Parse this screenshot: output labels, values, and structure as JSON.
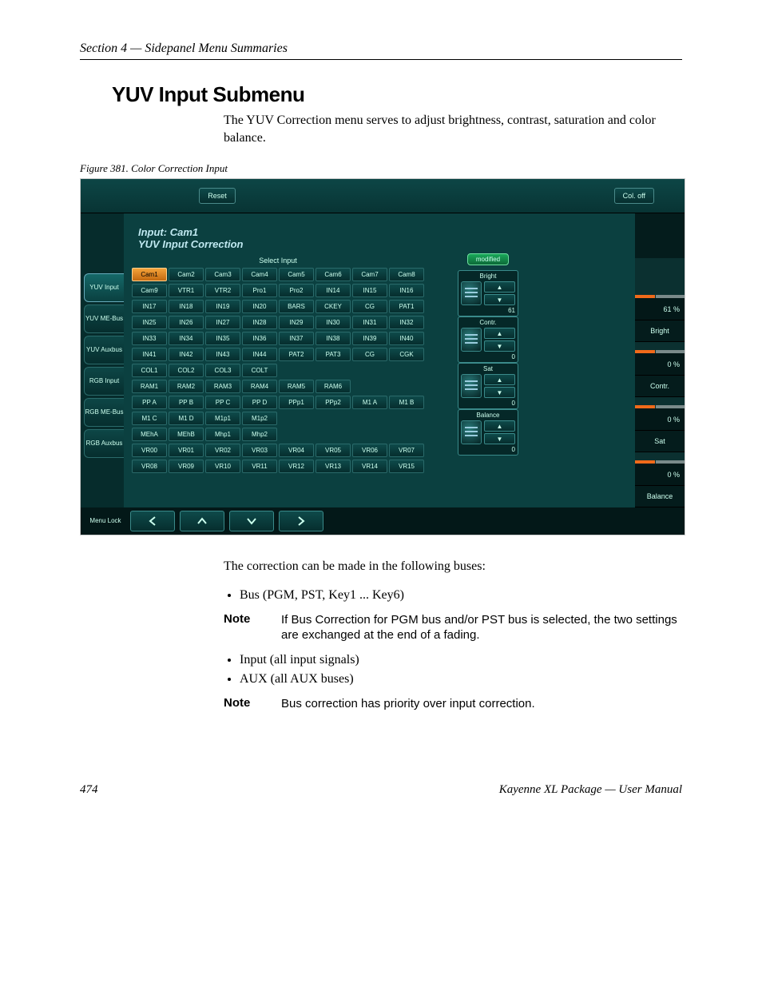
{
  "header": {
    "section": "Section 4 — Sidepanel Menu Summaries"
  },
  "title": "YUV Input Submenu",
  "intro": "The YUV Correction menu serves to adjust brightness, contrast, saturation and color balance.",
  "figure_caption": "Figure 381.  Color Correction Input",
  "ui": {
    "topbar": {
      "reset": "Reset",
      "coloff": "Col. off"
    },
    "panel_input": "Input:  Cam1",
    "panel_name": "YUV Input Correction",
    "select_label": "Select Input",
    "tabs": [
      "YUV Input",
      "YUV ME-Bus",
      "YUV Auxbus",
      "RGB Input",
      "RGB ME-Bus",
      "RGB Auxbus"
    ],
    "grid": [
      [
        "Cam1",
        "Cam2",
        "Cam3",
        "Cam4",
        "Cam5",
        "Cam6",
        "Cam7",
        "Cam8"
      ],
      [
        "Cam9",
        "VTR1",
        "VTR2",
        "Pro1",
        "Pro2",
        "IN14",
        "IN15",
        "IN16"
      ],
      [
        "IN17",
        "IN18",
        "IN19",
        "IN20",
        "BARS",
        "CKEY",
        "CG",
        "PAT1"
      ],
      [
        "IN25",
        "IN26",
        "IN27",
        "IN28",
        "IN29",
        "IN30",
        "IN31",
        "IN32"
      ],
      [
        "IN33",
        "IN34",
        "IN35",
        "IN36",
        "IN37",
        "IN38",
        "IN39",
        "IN40"
      ],
      [
        "IN41",
        "IN42",
        "IN43",
        "IN44",
        "PAT2",
        "PAT3",
        "CG",
        "CGK"
      ],
      [
        "COL1",
        "COL2",
        "COL3",
        "COLT",
        "",
        "",
        "",
        ""
      ],
      [
        "RAM1",
        "RAM2",
        "RAM3",
        "RAM4",
        "RAM5",
        "RAM6",
        "",
        ""
      ],
      [
        "PP A",
        "PP B",
        "PP C",
        "PP D",
        "PPp1",
        "PPp2",
        "M1 A",
        "M1 B"
      ],
      [
        "M1 C",
        "M1 D",
        "M1p1",
        "M1p2",
        "",
        "",
        "",
        ""
      ],
      [
        "MEhA",
        "MEhB",
        "Mhp1",
        "Mhp2",
        "",
        "",
        "",
        ""
      ],
      [
        "VR00",
        "VR01",
        "VR02",
        "VR03",
        "VR04",
        "VR05",
        "VR06",
        "VR07"
      ],
      [
        "VR08",
        "VR09",
        "VR10",
        "VR11",
        "VR12",
        "VR13",
        "VR14",
        "VR15"
      ]
    ],
    "selected_input": "Cam1",
    "modified": "modified",
    "params": [
      {
        "label": "Bright",
        "value": "61"
      },
      {
        "label": "Contr.",
        "value": "0"
      },
      {
        "label": "Sat",
        "value": "0"
      },
      {
        "label": "Balance",
        "value": "0"
      }
    ],
    "right": [
      {
        "value": "61 %",
        "label": "Bright"
      },
      {
        "value": "0 %",
        "label": "Contr."
      },
      {
        "value": "0 %",
        "label": "Sat"
      },
      {
        "value": "0 %",
        "label": "Balance"
      }
    ],
    "menu_lock": "Menu Lock"
  },
  "post_text": "The correction can be made in the following buses:",
  "bullets1": [
    "Bus (PGM, PST, Key1 ... Key6)"
  ],
  "note1_label": "Note",
  "note1_text": "If Bus Correction for PGM bus and/or PST bus is selected, the two settings are exchanged at the end of a fading.",
  "bullets2": [
    "Input (all input signals)",
    "AUX (all AUX buses)"
  ],
  "note2_label": "Note",
  "note2_text": "Bus correction has priority over input correction.",
  "footer": {
    "page": "474",
    "doc": "Kayenne XL Package  —  User Manual"
  }
}
